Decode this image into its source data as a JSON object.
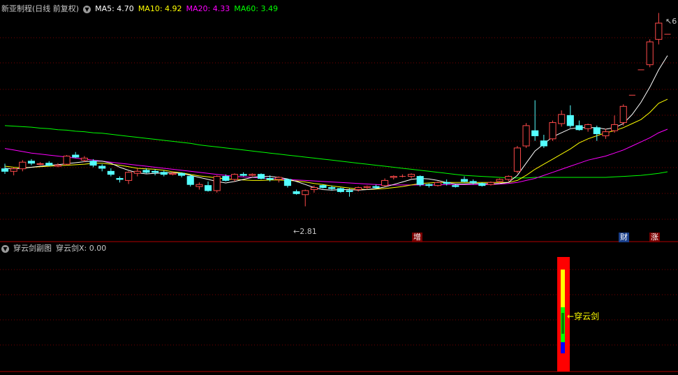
{
  "main_header": {
    "title": "新亚制程(日线 前复权)",
    "ma5": "MA5: 4.70",
    "ma10": "MA10: 4.92",
    "ma20": "MA20: 4.33",
    "ma60": "MA60: 3.49",
    "colors": {
      "ma5": "#ffffff",
      "ma10": "#ffff00",
      "ma20": "#ff00ff",
      "ma60": "#00ff00"
    }
  },
  "sub_header": {
    "title": "穿云剑副图",
    "value": "穿云剑X: 0.00"
  },
  "annotations": {
    "low_label": "2.81",
    "high_label": "6",
    "marker_zeng": "增",
    "marker_cai": "财",
    "marker_zhang": "涨",
    "signal_label": "穿云剑"
  },
  "chart_data": [
    {
      "type": "candlestick",
      "title": "新亚制程(日线 前复权)",
      "ylim": [
        2.5,
        6.6
      ],
      "candles_ohlc": [
        [
          3.55,
          3.65,
          3.45,
          3.5
        ],
        [
          3.5,
          3.58,
          3.42,
          3.55
        ],
        [
          3.55,
          3.72,
          3.5,
          3.68
        ],
        [
          3.7,
          3.74,
          3.62,
          3.66
        ],
        [
          3.64,
          3.68,
          3.62,
          3.65
        ],
        [
          3.66,
          3.7,
          3.6,
          3.62
        ],
        [
          3.6,
          3.66,
          3.58,
          3.62
        ],
        [
          3.64,
          3.82,
          3.62,
          3.8
        ],
        [
          3.82,
          3.88,
          3.76,
          3.78
        ],
        [
          3.72,
          3.8,
          3.68,
          3.76
        ],
        [
          3.7,
          3.74,
          3.58,
          3.62
        ],
        [
          3.6,
          3.64,
          3.5,
          3.56
        ],
        [
          3.5,
          3.56,
          3.4,
          3.44
        ],
        [
          3.36,
          3.4,
          3.28,
          3.34
        ],
        [
          3.32,
          3.5,
          3.25,
          3.48
        ],
        [
          3.46,
          3.56,
          3.4,
          3.5
        ],
        [
          3.52,
          3.56,
          3.46,
          3.48
        ],
        [
          3.5,
          3.54,
          3.42,
          3.48
        ],
        [
          3.48,
          3.52,
          3.4,
          3.44
        ],
        [
          3.44,
          3.5,
          3.42,
          3.46
        ],
        [
          3.46,
          3.48,
          3.38,
          3.42
        ],
        [
          3.4,
          3.44,
          3.2,
          3.24
        ],
        [
          3.2,
          3.28,
          3.14,
          3.24
        ],
        [
          3.22,
          3.3,
          3.1,
          3.12
        ],
        [
          3.12,
          3.42,
          3.08,
          3.4
        ],
        [
          3.4,
          3.44,
          3.3,
          3.32
        ],
        [
          3.34,
          3.46,
          3.3,
          3.44
        ],
        [
          3.44,
          3.48,
          3.4,
          3.42
        ],
        [
          3.42,
          3.46,
          3.4,
          3.44
        ],
        [
          3.44,
          3.46,
          3.34,
          3.36
        ],
        [
          3.36,
          3.42,
          3.3,
          3.34
        ],
        [
          3.34,
          3.4,
          3.28,
          3.38
        ],
        [
          3.34,
          3.36,
          3.18,
          3.22
        ],
        [
          3.1,
          3.14,
          3.04,
          3.06
        ],
        [
          3.04,
          3.14,
          2.81,
          3.12
        ],
        [
          3.14,
          3.22,
          3.08,
          3.18
        ],
        [
          3.22,
          3.24,
          3.16,
          3.18
        ],
        [
          3.18,
          3.22,
          3.12,
          3.16
        ],
        [
          3.16,
          3.18,
          3.08,
          3.1
        ],
        [
          3.12,
          3.16,
          3.0,
          3.1
        ],
        [
          3.14,
          3.2,
          3.1,
          3.18
        ],
        [
          3.18,
          3.22,
          3.14,
          3.2
        ],
        [
          3.2,
          3.24,
          3.16,
          3.18
        ],
        [
          3.22,
          3.36,
          3.2,
          3.32
        ],
        [
          3.38,
          3.42,
          3.34,
          3.4
        ],
        [
          3.4,
          3.44,
          3.38,
          3.4
        ],
        [
          3.4,
          3.46,
          3.36,
          3.44
        ],
        [
          3.4,
          3.42,
          3.2,
          3.24
        ],
        [
          3.24,
          3.26,
          3.18,
          3.22
        ],
        [
          3.22,
          3.3,
          3.2,
          3.28
        ],
        [
          3.28,
          3.34,
          3.22,
          3.26
        ],
        [
          3.22,
          3.24,
          3.18,
          3.2
        ],
        [
          3.34,
          3.4,
          3.28,
          3.3
        ],
        [
          3.3,
          3.34,
          3.24,
          3.28
        ],
        [
          3.26,
          3.28,
          3.2,
          3.22
        ],
        [
          3.24,
          3.3,
          3.22,
          3.28
        ],
        [
          3.3,
          3.36,
          3.26,
          3.34
        ],
        [
          3.34,
          3.42,
          3.3,
          3.4
        ],
        [
          3.5,
          4.0,
          3.46,
          3.96
        ],
        [
          4.0,
          4.45,
          3.96,
          4.4
        ],
        [
          4.3,
          4.9,
          4.1,
          4.2
        ],
        [
          4.1,
          4.22,
          3.96,
          4.0
        ],
        [
          4.14,
          4.5,
          4.1,
          4.46
        ],
        [
          4.44,
          4.7,
          4.38,
          4.62
        ],
        [
          4.6,
          4.8,
          4.36,
          4.4
        ],
        [
          4.4,
          4.5,
          4.3,
          4.32
        ],
        [
          4.34,
          4.44,
          4.28,
          4.42
        ],
        [
          4.36,
          4.4,
          4.1,
          4.24
        ],
        [
          4.2,
          4.34,
          4.14,
          4.28
        ],
        [
          4.3,
          4.6,
          4.26,
          4.42
        ],
        [
          4.46,
          4.82,
          4.4,
          4.78
        ],
        [
          5.0,
          5.0,
          5.0,
          5.0
        ],
        [
          5.5,
          5.5,
          5.5,
          5.5
        ],
        [
          5.6,
          6.1,
          5.55,
          6.05
        ],
        [
          6.1,
          6.62,
          6.0,
          6.42
        ],
        [
          6.2,
          6.2,
          6.2,
          6.2
        ]
      ],
      "ma5": [
        3.56,
        3.55,
        3.56,
        3.58,
        3.6,
        3.62,
        3.63,
        3.65,
        3.67,
        3.69,
        3.7,
        3.7,
        3.66,
        3.58,
        3.52,
        3.47,
        3.45,
        3.46,
        3.47,
        3.47,
        3.46,
        3.42,
        3.38,
        3.34,
        3.3,
        3.27,
        3.3,
        3.34,
        3.38,
        3.4,
        3.4,
        3.38,
        3.35,
        3.3,
        3.24,
        3.18,
        3.14,
        3.13,
        3.14,
        3.14,
        3.13,
        3.14,
        3.16,
        3.19,
        3.24,
        3.29,
        3.34,
        3.36,
        3.35,
        3.32,
        3.28,
        3.25,
        3.25,
        3.26,
        3.26,
        3.25,
        3.26,
        3.28,
        3.42,
        3.66,
        3.9,
        4.04,
        4.18,
        4.26,
        4.34,
        4.36,
        4.36,
        4.36,
        4.33,
        4.36,
        4.44,
        4.62,
        4.86,
        5.16,
        5.5,
        5.78
      ],
      "ma10": [
        3.6,
        3.58,
        3.57,
        3.58,
        3.59,
        3.6,
        3.61,
        3.62,
        3.63,
        3.64,
        3.66,
        3.66,
        3.64,
        3.62,
        3.59,
        3.56,
        3.55,
        3.54,
        3.52,
        3.49,
        3.47,
        3.44,
        3.41,
        3.39,
        3.37,
        3.35,
        3.34,
        3.33,
        3.32,
        3.32,
        3.33,
        3.33,
        3.32,
        3.31,
        3.29,
        3.26,
        3.24,
        3.21,
        3.19,
        3.17,
        3.15,
        3.14,
        3.15,
        3.16,
        3.18,
        3.2,
        3.23,
        3.26,
        3.27,
        3.28,
        3.28,
        3.28,
        3.28,
        3.28,
        3.28,
        3.28,
        3.28,
        3.28,
        3.32,
        3.42,
        3.54,
        3.64,
        3.74,
        3.84,
        3.94,
        4.06,
        4.14,
        4.2,
        4.26,
        4.3,
        4.36,
        4.44,
        4.52,
        4.66,
        4.84,
        4.92
      ],
      "ma20": [
        3.95,
        3.92,
        3.89,
        3.86,
        3.84,
        3.82,
        3.8,
        3.78,
        3.76,
        3.74,
        3.72,
        3.7,
        3.68,
        3.66,
        3.64,
        3.62,
        3.6,
        3.58,
        3.56,
        3.54,
        3.52,
        3.5,
        3.48,
        3.46,
        3.44,
        3.42,
        3.4,
        3.39,
        3.38,
        3.37,
        3.36,
        3.35,
        3.34,
        3.33,
        3.32,
        3.31,
        3.3,
        3.29,
        3.28,
        3.27,
        3.26,
        3.25,
        3.24,
        3.23,
        3.23,
        3.23,
        3.23,
        3.23,
        3.23,
        3.23,
        3.24,
        3.24,
        3.24,
        3.24,
        3.24,
        3.24,
        3.25,
        3.26,
        3.28,
        3.32,
        3.36,
        3.42,
        3.48,
        3.54,
        3.6,
        3.66,
        3.72,
        3.76,
        3.8,
        3.86,
        3.92,
        4.0,
        4.08,
        4.16,
        4.26,
        4.33
      ],
      "ma60": [
        4.4,
        4.39,
        4.38,
        4.37,
        4.35,
        4.34,
        4.32,
        4.31,
        4.29,
        4.28,
        4.26,
        4.25,
        4.23,
        4.21,
        4.19,
        4.17,
        4.15,
        4.13,
        4.11,
        4.09,
        4.07,
        4.05,
        4.02,
        4.0,
        3.98,
        3.96,
        3.94,
        3.92,
        3.9,
        3.88,
        3.86,
        3.84,
        3.82,
        3.8,
        3.78,
        3.76,
        3.74,
        3.72,
        3.7,
        3.68,
        3.66,
        3.64,
        3.62,
        3.6,
        3.58,
        3.56,
        3.54,
        3.52,
        3.5,
        3.48,
        3.46,
        3.44,
        3.42,
        3.41,
        3.4,
        3.39,
        3.38,
        3.37,
        3.37,
        3.37,
        3.38,
        3.38,
        3.38,
        3.38,
        3.38,
        3.38,
        3.38,
        3.38,
        3.38,
        3.39,
        3.4,
        3.41,
        3.42,
        3.44,
        3.46,
        3.49
      ]
    },
    {
      "type": "bar",
      "title": "穿云剑副图",
      "signal_index": 59,
      "value": 0.0,
      "segments": [
        "red",
        "yellow",
        "green",
        "blue"
      ]
    }
  ]
}
